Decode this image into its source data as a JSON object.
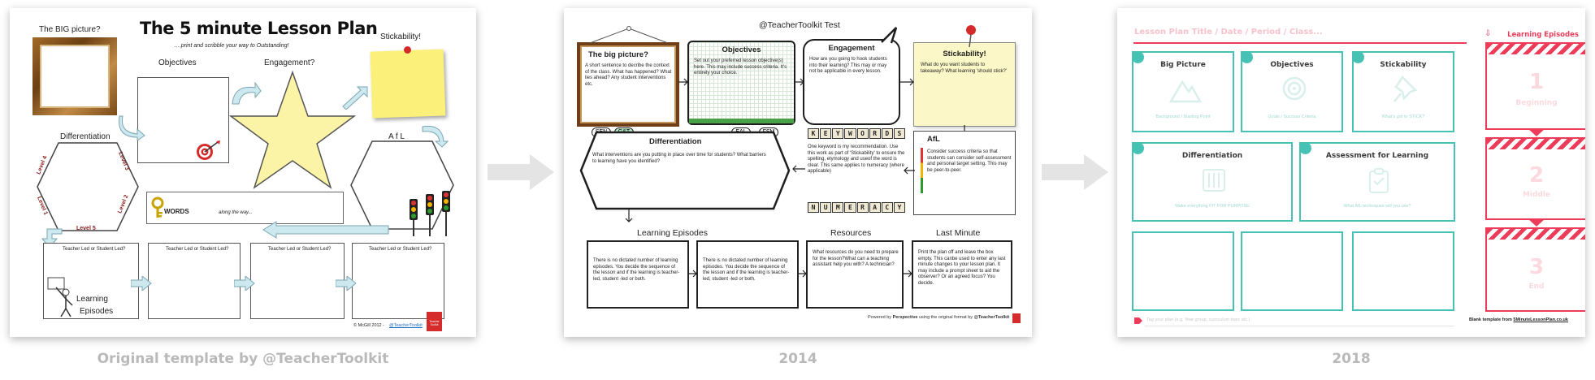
{
  "captions": {
    "original": "Original template by @TeacherToolkit",
    "v2014": "2014",
    "v2018": "2018"
  },
  "panel_original": {
    "title": "The 5 minute Lesson Plan",
    "subtitle": "....print and scribble your way to Outstanding!",
    "big_picture": "The BIG picture?",
    "objectives": "Objectives",
    "engagement": "Engagement?",
    "stickability": "Stickability!",
    "differentiation": "Differentiation",
    "level_labels": [
      "Level 1",
      "Level 2",
      "Level 3",
      "Level 4",
      "Level 5"
    ],
    "afl": "A f L",
    "words": "WORDS",
    "words_sub": "along the way...",
    "episode_prompt": "Teacher Led or Student Led?",
    "learning_episodes": [
      "Learning",
      "Episodes"
    ],
    "footer_copy": "© McGill 2012 -",
    "footer_link": "@TeacherToolkit",
    "badge": "Teacher Toolkit"
  },
  "panel_2014": {
    "header": "@TeacherToolkit Test",
    "big_picture_title": "The big picture?",
    "big_picture_text": "A short sentence to decribe the context of the class. What has happened? What lies ahead? Any student interventions etc.",
    "objectives_title": "Objectives",
    "objectives_text": "Set out your preferred lesson objective(s) here. This may include success criteria. It's entirely your choice.",
    "engagement_title": "Engagement",
    "engagement_text": "How are you going to hook students into their learning? This may or may not be applicable in every lesson.",
    "stickability_title": "Stickability!",
    "stickability_text": "What do you want students to takeaway? What learning 'should stick?'",
    "tags": [
      "SEN",
      "G&T",
      "EAL",
      "FSM"
    ],
    "differentiation_title": "Differentiation",
    "differentiation_text": "What interventions are you putting in place over time for students? What barriers to learning have you identified?",
    "keywords_tiles": [
      "K",
      "E",
      "Y",
      "W",
      "O",
      "R",
      "D",
      "S"
    ],
    "keywords_text": "One keyword is my recommendation. Use this work as part of 'Stickability' to ensure the spelling, etymology and useof the word is clear. This same applies to numeracy (where applicable)",
    "numeracy_tiles": [
      "N",
      "U",
      "M",
      "E",
      "R",
      "A",
      "C",
      "Y"
    ],
    "afl_title": "AfL",
    "afl_text": "Consider success criteria so that students can consider self-assessment and personal target setting. This may be peer-to-peer.",
    "episodes_title": "Learning Episodes",
    "resources_title": "Resources",
    "last_minute_title": "Last Minute",
    "episode_text_a": "There is no dictated number of learning episodes. You decide the sequence of the lesson and if the learning is teacher-led, student -led or both.",
    "episode_text_b": "There is no dictated number of learning episodes. You decide the sequence of the lesson and if the learning is teacher-led, student -led or both.",
    "resources_text": "What resources do you need to prepare for the lesson?What can a teaching assistant help you with? A technician?",
    "last_minute_text": "Print the plan off and leave the box empty. This canbe used to enter any last minute changes to your lesson plan. It may include a prompt sheet to aid the observer? Or an agreed focus? You decide.",
    "footer_powered": "Powered by",
    "footer_brand": "Perspective",
    "footer_mid": "using the original format by",
    "footer_author": "@TeacherToolkit"
  },
  "panel_2018": {
    "title_line": "Lesson Plan Title  /  Date  /  Period  /  Class...",
    "episodes_heading": "Learning Episodes",
    "big_picture": "Big Picture",
    "big_picture_sub": "Background / Starting Point",
    "objectives": "Objectives",
    "objectives_sub": "Goals / Success Criteria",
    "stickability": "Stickability",
    "stickability_sub": "What's got to STICK?",
    "differentiation": "Differentiation",
    "differentiation_sub": "Make everything FIT FOR PURPOSE",
    "assessment": "Assessment for Learning",
    "assessment_sub": "What AfL techniques will you use?",
    "footer_note": "Tag your plan (e.g. Year group, curriculum topic etc.)",
    "episodes": [
      {
        "num": "1",
        "label": "Beginning"
      },
      {
        "num": "2",
        "label": "Middle"
      },
      {
        "num": "3",
        "label": "End"
      }
    ],
    "footer_blank": "Blank template from",
    "footer_site": "5MinuteLessonPlan.co.uk",
    "colors": {
      "teal": "#46c2b4",
      "red": "#ec3c5a"
    }
  }
}
